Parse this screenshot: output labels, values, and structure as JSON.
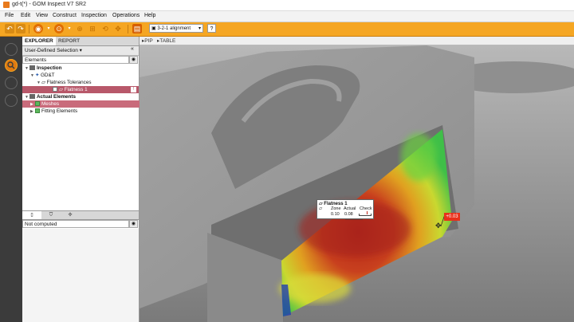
{
  "window": {
    "title": "gd-t(*) - GOM Inspect V7 SR2"
  },
  "menu": [
    "File",
    "Edit",
    "View",
    "Construct",
    "Inspection",
    "Operations",
    "Help"
  ],
  "toolbar": {
    "alignment": "3-2-1 alignment",
    "help": "?"
  },
  "panel": {
    "tabs": [
      "EXPLORER",
      "REPORT"
    ],
    "selection": "User-Defined Selection",
    "collapse": "«",
    "elements_label": "Elements",
    "tree": [
      {
        "label": "Inspection",
        "level": 0,
        "bold": true
      },
      {
        "label": "GD&T",
        "level": 1
      },
      {
        "label": "Flatness Tolerances",
        "level": 2
      },
      {
        "label": "Flatness 1",
        "level": 3,
        "selected": true
      },
      {
        "label": "Actual Elements",
        "level": 0,
        "bold": true
      },
      {
        "label": "Meshes",
        "level": 1,
        "selected": true
      },
      {
        "label": "Fitting Elements",
        "level": 1
      }
    ],
    "status": "Not computed"
  },
  "viewport": {
    "header": [
      "PIP",
      "TABLE"
    ],
    "label": {
      "title": "Flatness 1",
      "headers": [
        "Zone",
        "Actual",
        "Check"
      ],
      "values": [
        "0.10",
        "0.08"
      ]
    },
    "deviation_tag": "+0.03"
  },
  "colors": {
    "accent": "#f5a623",
    "selection": "#b8586a",
    "deviation": "#e8301a"
  }
}
